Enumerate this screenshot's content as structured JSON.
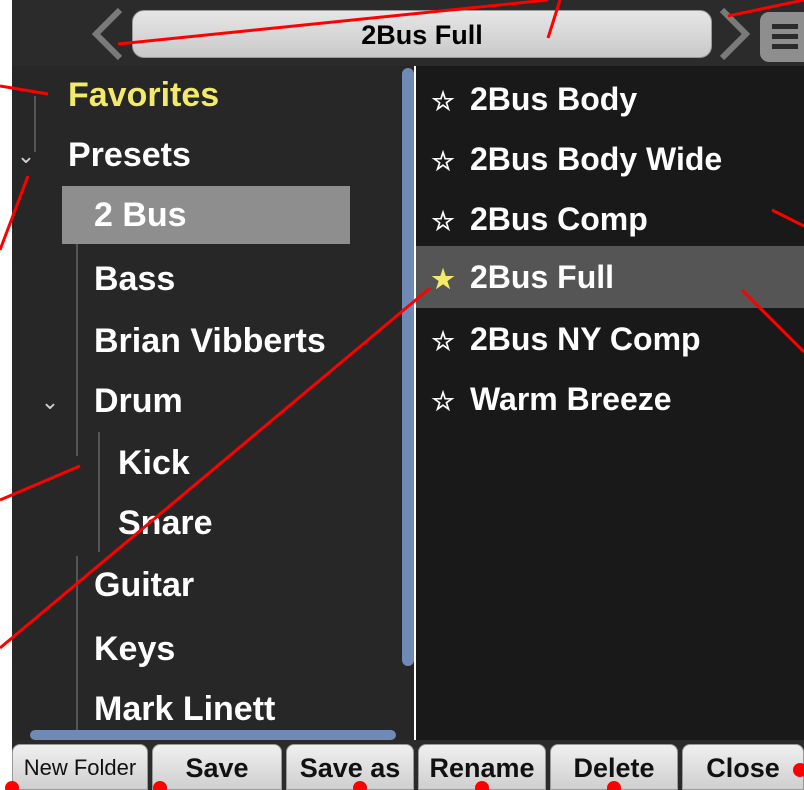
{
  "header": {
    "current_preset": "2Bus Full",
    "prev_icon": "chevron-left-icon",
    "next_icon": "chevron-right-icon",
    "menu_icon": "hamburger-menu-icon"
  },
  "tree": {
    "items": [
      {
        "label": "Favorites"
      },
      {
        "label": "Presets"
      },
      {
        "label": "2 Bus"
      },
      {
        "label": "Bass"
      },
      {
        "label": "Brian Vibberts"
      },
      {
        "label": "Drum"
      },
      {
        "label": "Kick"
      },
      {
        "label": "Snare"
      },
      {
        "label": "Guitar"
      },
      {
        "label": "Keys"
      },
      {
        "label": "Mark Linett"
      }
    ]
  },
  "presets": {
    "items": [
      {
        "label": "2Bus Body",
        "star": "☆",
        "favorite": false
      },
      {
        "label": "2Bus Body Wide",
        "star": "☆",
        "favorite": false
      },
      {
        "label": "2Bus Comp",
        "star": "☆",
        "favorite": false
      },
      {
        "label": "2Bus Full",
        "star": "★",
        "favorite": true
      },
      {
        "label": "2Bus NY Comp",
        "star": "☆",
        "favorite": false
      },
      {
        "label": "Warm Breeze",
        "star": "☆",
        "favorite": false
      }
    ]
  },
  "toolbar": {
    "new_folder": "New Folder",
    "save": "Save",
    "save_as": "Save as",
    "rename": "Rename",
    "delete": "Delete",
    "close": "Close"
  },
  "colors": {
    "favorite_yellow": "#f3e96a",
    "annotation_red": "#ff0000",
    "scrollbar_blue": "#6f8ab5",
    "selected_gray": "#8e8e8e"
  }
}
